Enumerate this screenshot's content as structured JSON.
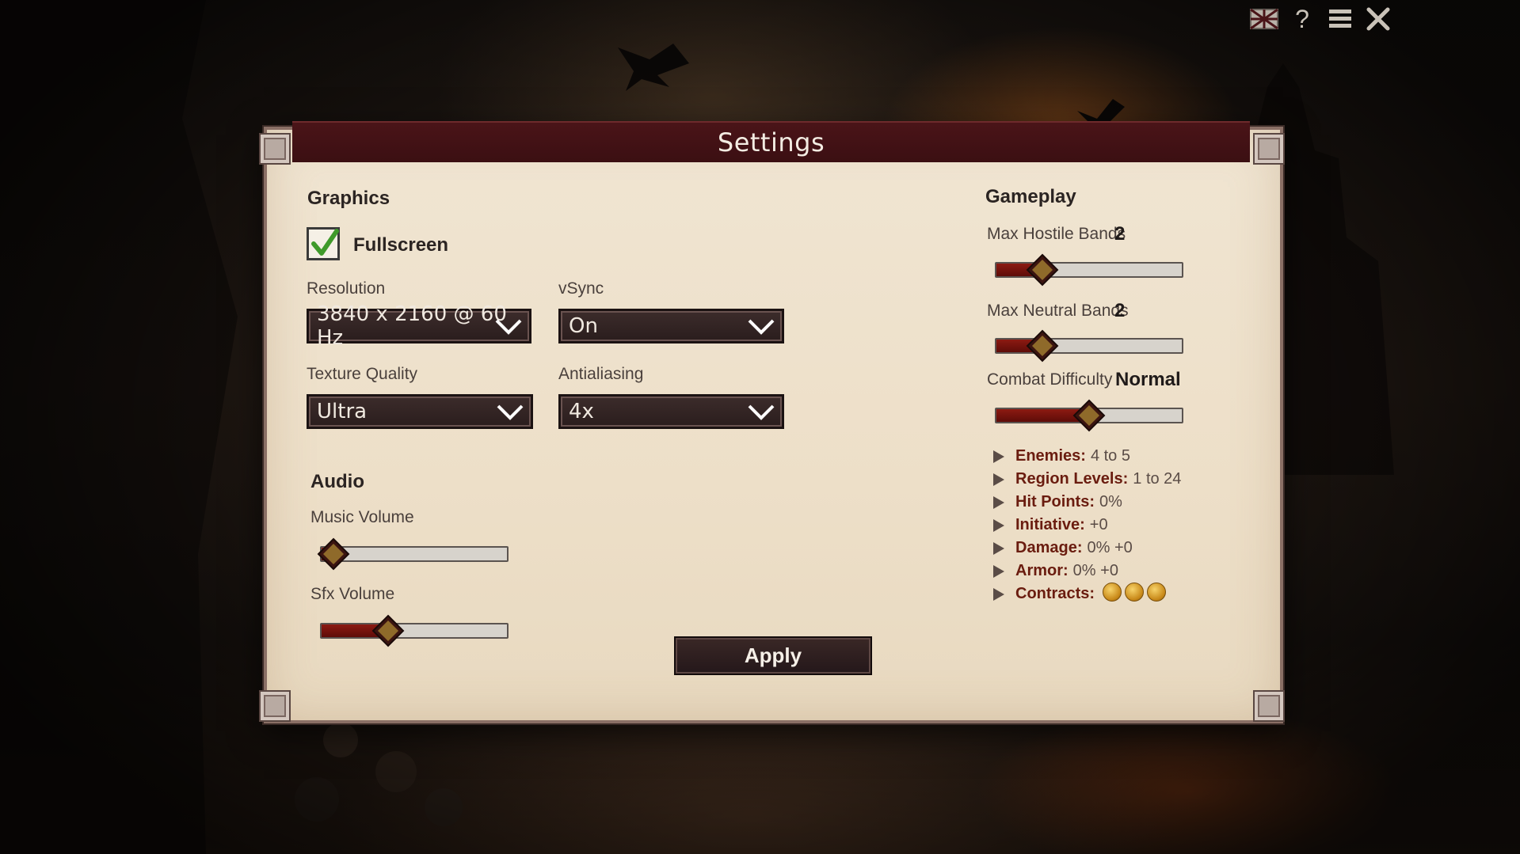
{
  "window": {
    "title": "Settings"
  },
  "top_bar": {
    "icons": [
      "flag-icon",
      "help-icon",
      "menu-icon",
      "close-icon"
    ],
    "help_glyph": "?",
    "menu_glyph": "≡",
    "close_glyph": "✕"
  },
  "graphics": {
    "title": "Graphics",
    "fullscreen": {
      "label": "Fullscreen",
      "checked": true
    },
    "resolution": {
      "label": "Resolution",
      "value": "3840 x 2160 @ 60 Hz"
    },
    "vsync": {
      "label": "vSync",
      "value": "On"
    },
    "texture_quality": {
      "label": "Texture Quality",
      "value": "Ultra"
    },
    "antialiasing": {
      "label": "Antialiasing",
      "value": "4x"
    }
  },
  "audio": {
    "title": "Audio",
    "music_volume": {
      "label": "Music Volume",
      "level": 0.07
    },
    "sfx_volume": {
      "label": "Sfx Volume",
      "level": 0.36
    }
  },
  "gameplay": {
    "title": "Gameplay",
    "max_hostile_bands": {
      "label": "Max Hostile Bands",
      "value": "2",
      "level": 0.25
    },
    "max_neutral_bands": {
      "label": "Max Neutral Bands",
      "value": "2",
      "level": 0.25
    },
    "combat_difficulty": {
      "label": "Combat Difficulty",
      "value": "Normal",
      "level": 0.5
    },
    "stats": [
      {
        "key": "Enemies:",
        "value": "4 to 5"
      },
      {
        "key": "Region Levels:",
        "value": "1 to 24"
      },
      {
        "key": "Hit Points:",
        "value": "0%"
      },
      {
        "key": "Initiative:",
        "value": "+0"
      },
      {
        "key": "Damage:",
        "value": "0% +0"
      },
      {
        "key": "Armor:",
        "value": " 0% +0"
      },
      {
        "key": "Contracts:",
        "value": "",
        "coins": 3
      }
    ]
  },
  "apply_label": "Apply",
  "colors": {
    "panel": "#eddfc8",
    "header": "#3b0f12",
    "slider_fill": "#7a140e",
    "accent_text": "#6a1c0f"
  }
}
